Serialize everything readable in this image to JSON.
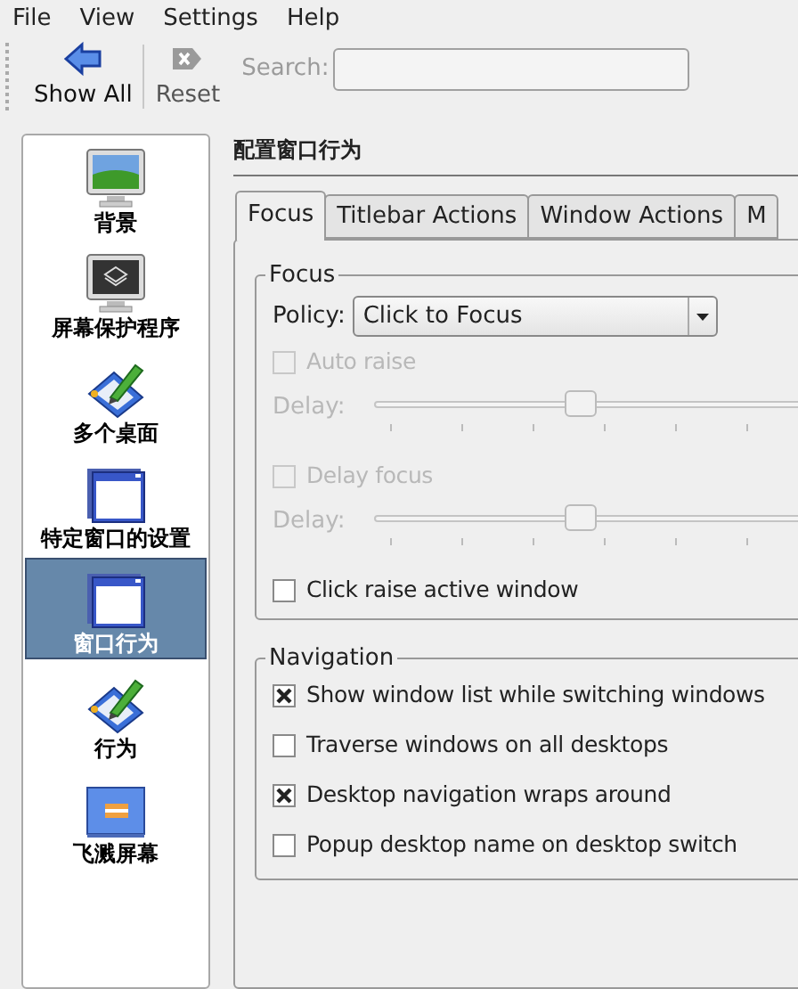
{
  "menu": [
    "File",
    "View",
    "Settings",
    "Help"
  ],
  "toolbar": {
    "buttons": [
      {
        "label": "Show All",
        "kind": "back",
        "disabled": false
      },
      {
        "label": "Reset",
        "kind": "reset",
        "disabled": true
      }
    ],
    "search": {
      "label": "Search:",
      "disabled": true
    }
  },
  "sidebar": {
    "items": [
      {
        "label": "背景",
        "kind": "wallpaper",
        "selected": false
      },
      {
        "label": "屏幕保护程序",
        "kind": "screensaver",
        "selected": false
      },
      {
        "label": "多个桌面",
        "kind": "tablet",
        "selected": false
      },
      {
        "label": "特定窗口的设置",
        "kind": "window",
        "selected": false
      },
      {
        "label": "窗口行为",
        "kind": "window",
        "selected": true
      },
      {
        "label": "行为",
        "kind": "tablet",
        "selected": false
      },
      {
        "label": "飞溅屏幕",
        "kind": "splash",
        "selected": false
      }
    ]
  },
  "page_title": "配置窗口行为",
  "tabs": [
    {
      "label": "Focus",
      "selected": true
    },
    {
      "label": "Titlebar Actions",
      "selected": false
    },
    {
      "label": "Window Actions",
      "selected": false
    },
    {
      "label": "M",
      "selected": false
    }
  ],
  "focus_group": {
    "title": "Focus",
    "policy": {
      "label": "Policy:",
      "value": "Click to Focus"
    },
    "rows": [
      {
        "kind": "checkbox",
        "label": "Auto raise",
        "checked": false,
        "disabled": true
      },
      {
        "kind": "slider",
        "label": "Delay:",
        "level": 0.4,
        "disabled": true
      },
      {
        "kind": "checkbox",
        "label": "Delay focus",
        "checked": false,
        "disabled": true
      },
      {
        "kind": "slider",
        "label": "Delay:",
        "level": 0.4,
        "disabled": true
      },
      {
        "kind": "checkbox",
        "label": "Click raise active window",
        "checked": false,
        "disabled": false
      }
    ]
  },
  "navigation_group": {
    "title": "Navigation",
    "rows": [
      {
        "kind": "checkbox",
        "label": "Show window list while switching windows",
        "checked": true,
        "disabled": false
      },
      {
        "kind": "checkbox",
        "label": "Traverse windows on all desktops",
        "checked": false,
        "disabled": false
      },
      {
        "kind": "checkbox",
        "label": "Desktop navigation wraps around",
        "checked": true,
        "disabled": false
      },
      {
        "kind": "checkbox",
        "label": "Popup desktop name on desktop switch",
        "checked": false,
        "disabled": false
      }
    ]
  }
}
